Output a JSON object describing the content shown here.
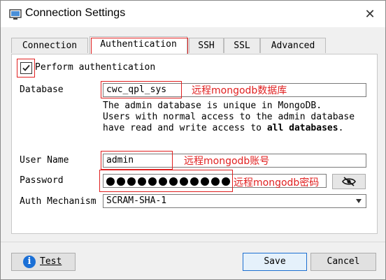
{
  "window": {
    "title": "Connection Settings",
    "close_glyph": "✕"
  },
  "tabs": [
    {
      "label": "Connection",
      "active": false
    },
    {
      "label": "Authentication",
      "active": true
    },
    {
      "label": "SSH",
      "active": false
    },
    {
      "label": "SSL",
      "active": false
    },
    {
      "label": "Advanced",
      "active": false
    }
  ],
  "auth": {
    "perform_label": "Perform authentication",
    "perform_checked": true,
    "database_label": "Database",
    "database_value": "cwc_qpl_sys",
    "note_line1": "The admin database is unique in MongoDB.",
    "note_line2": "Users with normal access to the admin database",
    "note_line3_prefix": "have read and write access to ",
    "note_line3_bold": "all databases",
    "note_line3_suffix": ".",
    "username_label": "User Name",
    "username_value": "admin",
    "password_label": "Password",
    "password_dots": 12,
    "mechanism_label": "Auth Mechanism",
    "mechanism_value": "SCRAM-SHA-1"
  },
  "annotations": {
    "database_note": "远程mongodb数据库",
    "username_note": "远程mongodb账号",
    "password_note": "远程mongodb密码"
  },
  "buttons": {
    "test": "Test",
    "save": "Save",
    "cancel": "Cancel"
  },
  "icons": {
    "app": "monitor-icon",
    "close": "close-icon",
    "check": "checkmark-icon",
    "eye": "eye-slash-icon",
    "info": "info-icon"
  },
  "colors": {
    "annotation_red": "#e02020",
    "info_blue": "#1a6fd6",
    "primary_border": "#1e6fd0"
  }
}
